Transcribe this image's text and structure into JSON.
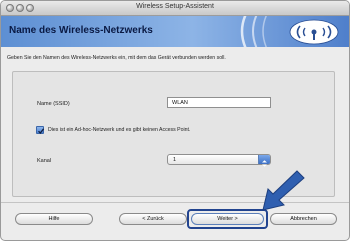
{
  "window": {
    "title": "Wireless Setup-Assistent"
  },
  "banner": {
    "heading": "Name des Wireless-Netzwerks",
    "logo_icon": "wireless-signal-icon",
    "colors": {
      "start": "#5d8fd3",
      "end": "#4f7fcb"
    }
  },
  "instruction": "Geben Sie den Namen des Wireless-Netzwerks ein, mit dem das Gerät verbunden werden soll.",
  "form": {
    "ssid_label": "Name (SSID)",
    "ssid_value": "WLAN",
    "adhoc_checked": true,
    "adhoc_label": "Dies ist ein Ad-hoc-Netzwerk und es gibt keinen Access Point.",
    "channel_label": "Kanal",
    "channel_value": "1"
  },
  "buttons": {
    "help": "Hilfe",
    "back": "< Zurück",
    "next": "Weiter >",
    "cancel": "Abbrechen"
  },
  "annotation": {
    "pointer_icon": "blue-arrow-icon",
    "color": "#2f5fb0"
  }
}
